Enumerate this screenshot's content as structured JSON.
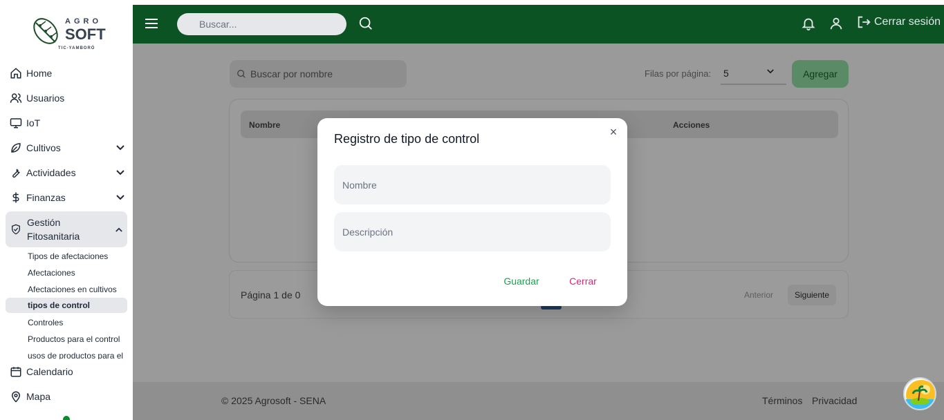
{
  "brand": {
    "logo_top": "AGRO",
    "logo_main": "SOFT",
    "logo_sub": "TIC-YAMBORÓ"
  },
  "header": {
    "search_placeholder": "Buscar...",
    "logout_label": "Cerrar sesión",
    "color": "#0b5323"
  },
  "sidebar": {
    "items": [
      {
        "label": "Home",
        "icon": "home-icon"
      },
      {
        "label": "Usuarios",
        "icon": "users-icon"
      },
      {
        "label": "IoT",
        "icon": "monitor-icon"
      },
      {
        "label": "Cultivos",
        "icon": "leaf-icon"
      },
      {
        "label": "Actividades",
        "icon": "wrench-icon"
      },
      {
        "label": "Finanzas",
        "icon": "dollar-icon"
      }
    ],
    "gestion": {
      "label_line1": "Gestión",
      "label_line2": "Fitosanitaria",
      "icon": "shield-check-icon"
    },
    "subitems": [
      "Tipos de afectaciones",
      "Afectaciones",
      "Afectaciones en cultivos",
      "tipos de control",
      "Controles",
      "Productos para el control",
      "usos de productos para el"
    ],
    "bottom": [
      {
        "label": "Calendario",
        "icon": "calendar-icon"
      },
      {
        "label": "Mapa",
        "icon": "map-pin-icon"
      }
    ]
  },
  "main": {
    "search_placeholder": "Buscar por nombre",
    "rows_label": "Filas por página:",
    "rows_value": "5",
    "add_label": "Agregar",
    "table": {
      "columns": [
        "Nombre",
        "Acciones"
      ]
    },
    "pager": {
      "info": "Página 1 de 0",
      "prev": "Anterior",
      "next": "Siguiente"
    }
  },
  "footer": {
    "copyright": "© 2025 Agrosoft - SENA",
    "terms": "Términos",
    "privacy": "Privacidad"
  },
  "modal": {
    "title": "Registro de tipo de control",
    "close_glyph": "×",
    "field_name_placeholder": "Nombre",
    "field_desc_placeholder": "Descripción",
    "save_label": "Guardar",
    "cancel_label": "Cerrar"
  }
}
